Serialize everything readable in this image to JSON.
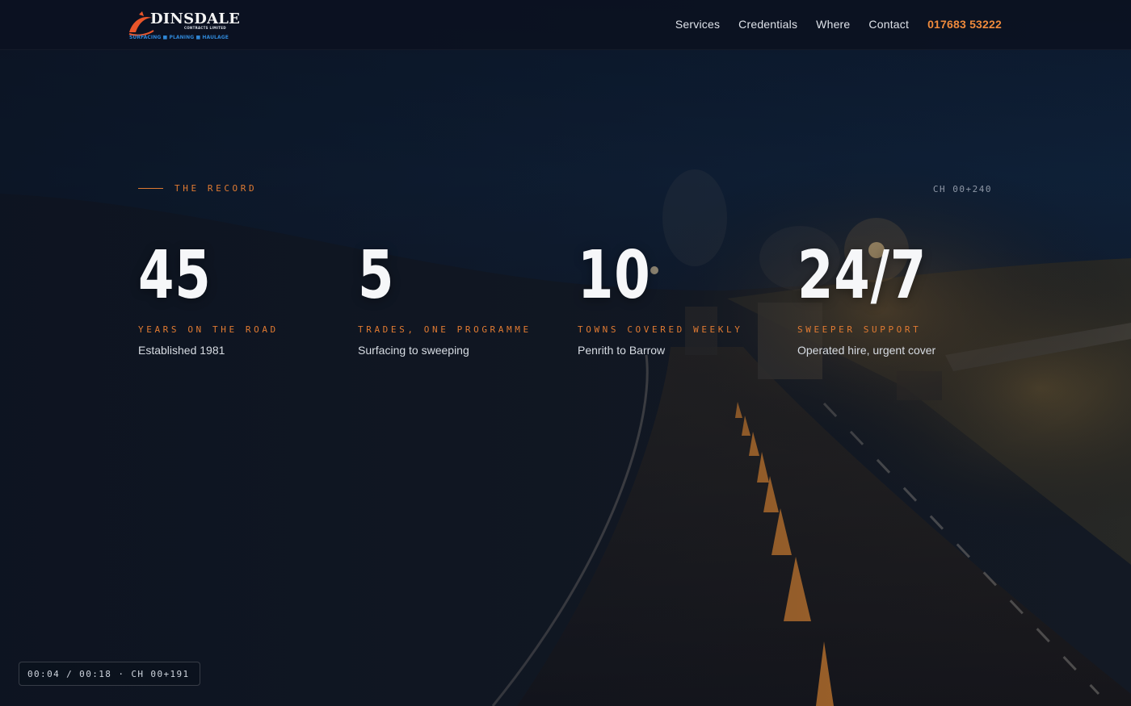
{
  "brand": {
    "name": "DINSDALE",
    "subtitle": "CONTRACTS LIMITED",
    "tagline": "SURFACING ■ PLANING ■ HAULAGE"
  },
  "nav": {
    "items": [
      "Services",
      "Credentials",
      "Where",
      "Contact"
    ],
    "phone": "017683 53222"
  },
  "section": {
    "label": "THE RECORD",
    "chainage": "CH 00+240"
  },
  "stats": [
    {
      "value": "45",
      "label": "YEARS ON THE ROAD",
      "sub": "Established 1981"
    },
    {
      "value": "5",
      "label": "TRADES, ONE PROGRAMME",
      "sub": "Surfacing to sweeping"
    },
    {
      "value": "10",
      "label": "TOWNS COVERED WEEKLY",
      "sub": "Penrith to Barrow"
    },
    {
      "value": "24/7",
      "label": "SWEEPER SUPPORT",
      "sub": "Operated hire, urgent cover"
    }
  ],
  "timecode": "00:04 / 00:18 · CH 00+191",
  "colors": {
    "accent": "#e07a32",
    "phone": "#ef8a3c",
    "background": "#0b1220",
    "brand_blue": "#2f86d6"
  },
  "icons": {
    "logo": "swoosh-logo-icon"
  }
}
